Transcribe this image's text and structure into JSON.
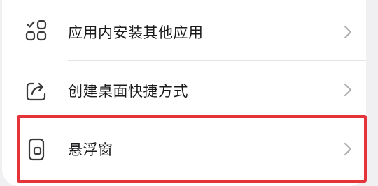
{
  "settings_list": {
    "items": [
      {
        "label": "应用内安装其他应用",
        "icon": "apps-grid-icon"
      },
      {
        "label": "创建桌面快捷方式",
        "icon": "share-shortcut-icon"
      },
      {
        "label": "悬浮窗",
        "icon": "floating-window-icon"
      }
    ],
    "chevron_icon": "chevron-right-icon"
  },
  "colors": {
    "background": "#f0f0f2",
    "card": "#ffffff",
    "text": "#1b1b1d",
    "icon": "#3a3a3c",
    "chevron": "#b0b0b3",
    "divider": "#e4e4e6",
    "highlight": "#e43439"
  },
  "highlight": {
    "target": "floating-window-row"
  }
}
